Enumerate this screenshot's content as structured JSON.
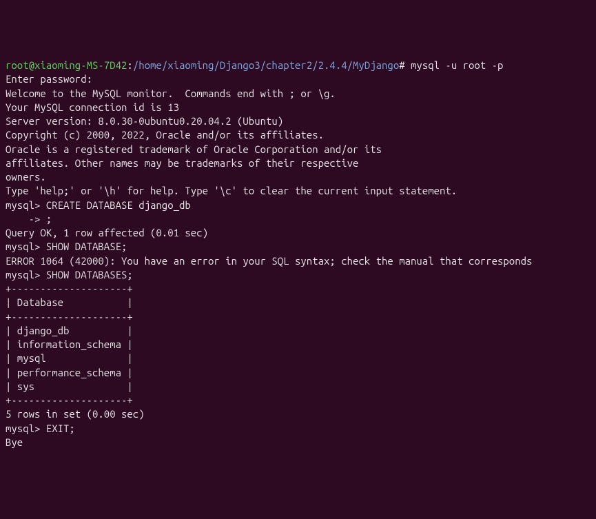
{
  "lines": {
    "l1_prompt_user": "root@xiaoming-MS-7D42",
    "l1_colon": ":",
    "l1_path": "/home/xiaoming/Django3/chapter2/2.4.4/MyDjango",
    "l1_hash": "# ",
    "l1_cmd": "mysql -u root -p",
    "l2": "Enter password:",
    "l3": "Welcome to the MySQL monitor.  Commands end with ; or \\g.",
    "l4": "Your MySQL connection id is 13",
    "l5": "Server version: 8.0.30-0ubuntu0.20.04.2 (Ubuntu)",
    "l6": "",
    "l7": "Copyright (c) 2000, 2022, Oracle and/or its affiliates.",
    "l8": "",
    "l9": "Oracle is a registered trademark of Oracle Corporation and/or its",
    "l10": "affiliates. Other names may be trademarks of their respective",
    "l11": "owners.",
    "l12": "",
    "l13": "Type 'help;' or '\\h' for help. Type '\\c' to clear the current input statement.",
    "l14": "",
    "l15": "mysql> CREATE DATABASE django_db",
    "l16": "    -> ;",
    "l17": "Query OK, 1 row affected (0.01 sec)",
    "l18": "",
    "l19": "mysql> SHOW DATABASE;",
    "l20": "ERROR 1064 (42000): You have an error in your SQL syntax; check the manual that corresponds",
    "l21": "mysql> SHOW DATABASES;",
    "l22": "+--------------------+",
    "l23": "| Database           |",
    "l24": "+--------------------+",
    "l25": "| django_db          |",
    "l26": "| information_schema |",
    "l27": "| mysql              |",
    "l28": "| performance_schema |",
    "l29": "| sys                |",
    "l30": "+--------------------+",
    "l31": "5 rows in set (0.00 sec)",
    "l32": "",
    "l33": "mysql> EXIT;",
    "l34": "Bye"
  }
}
